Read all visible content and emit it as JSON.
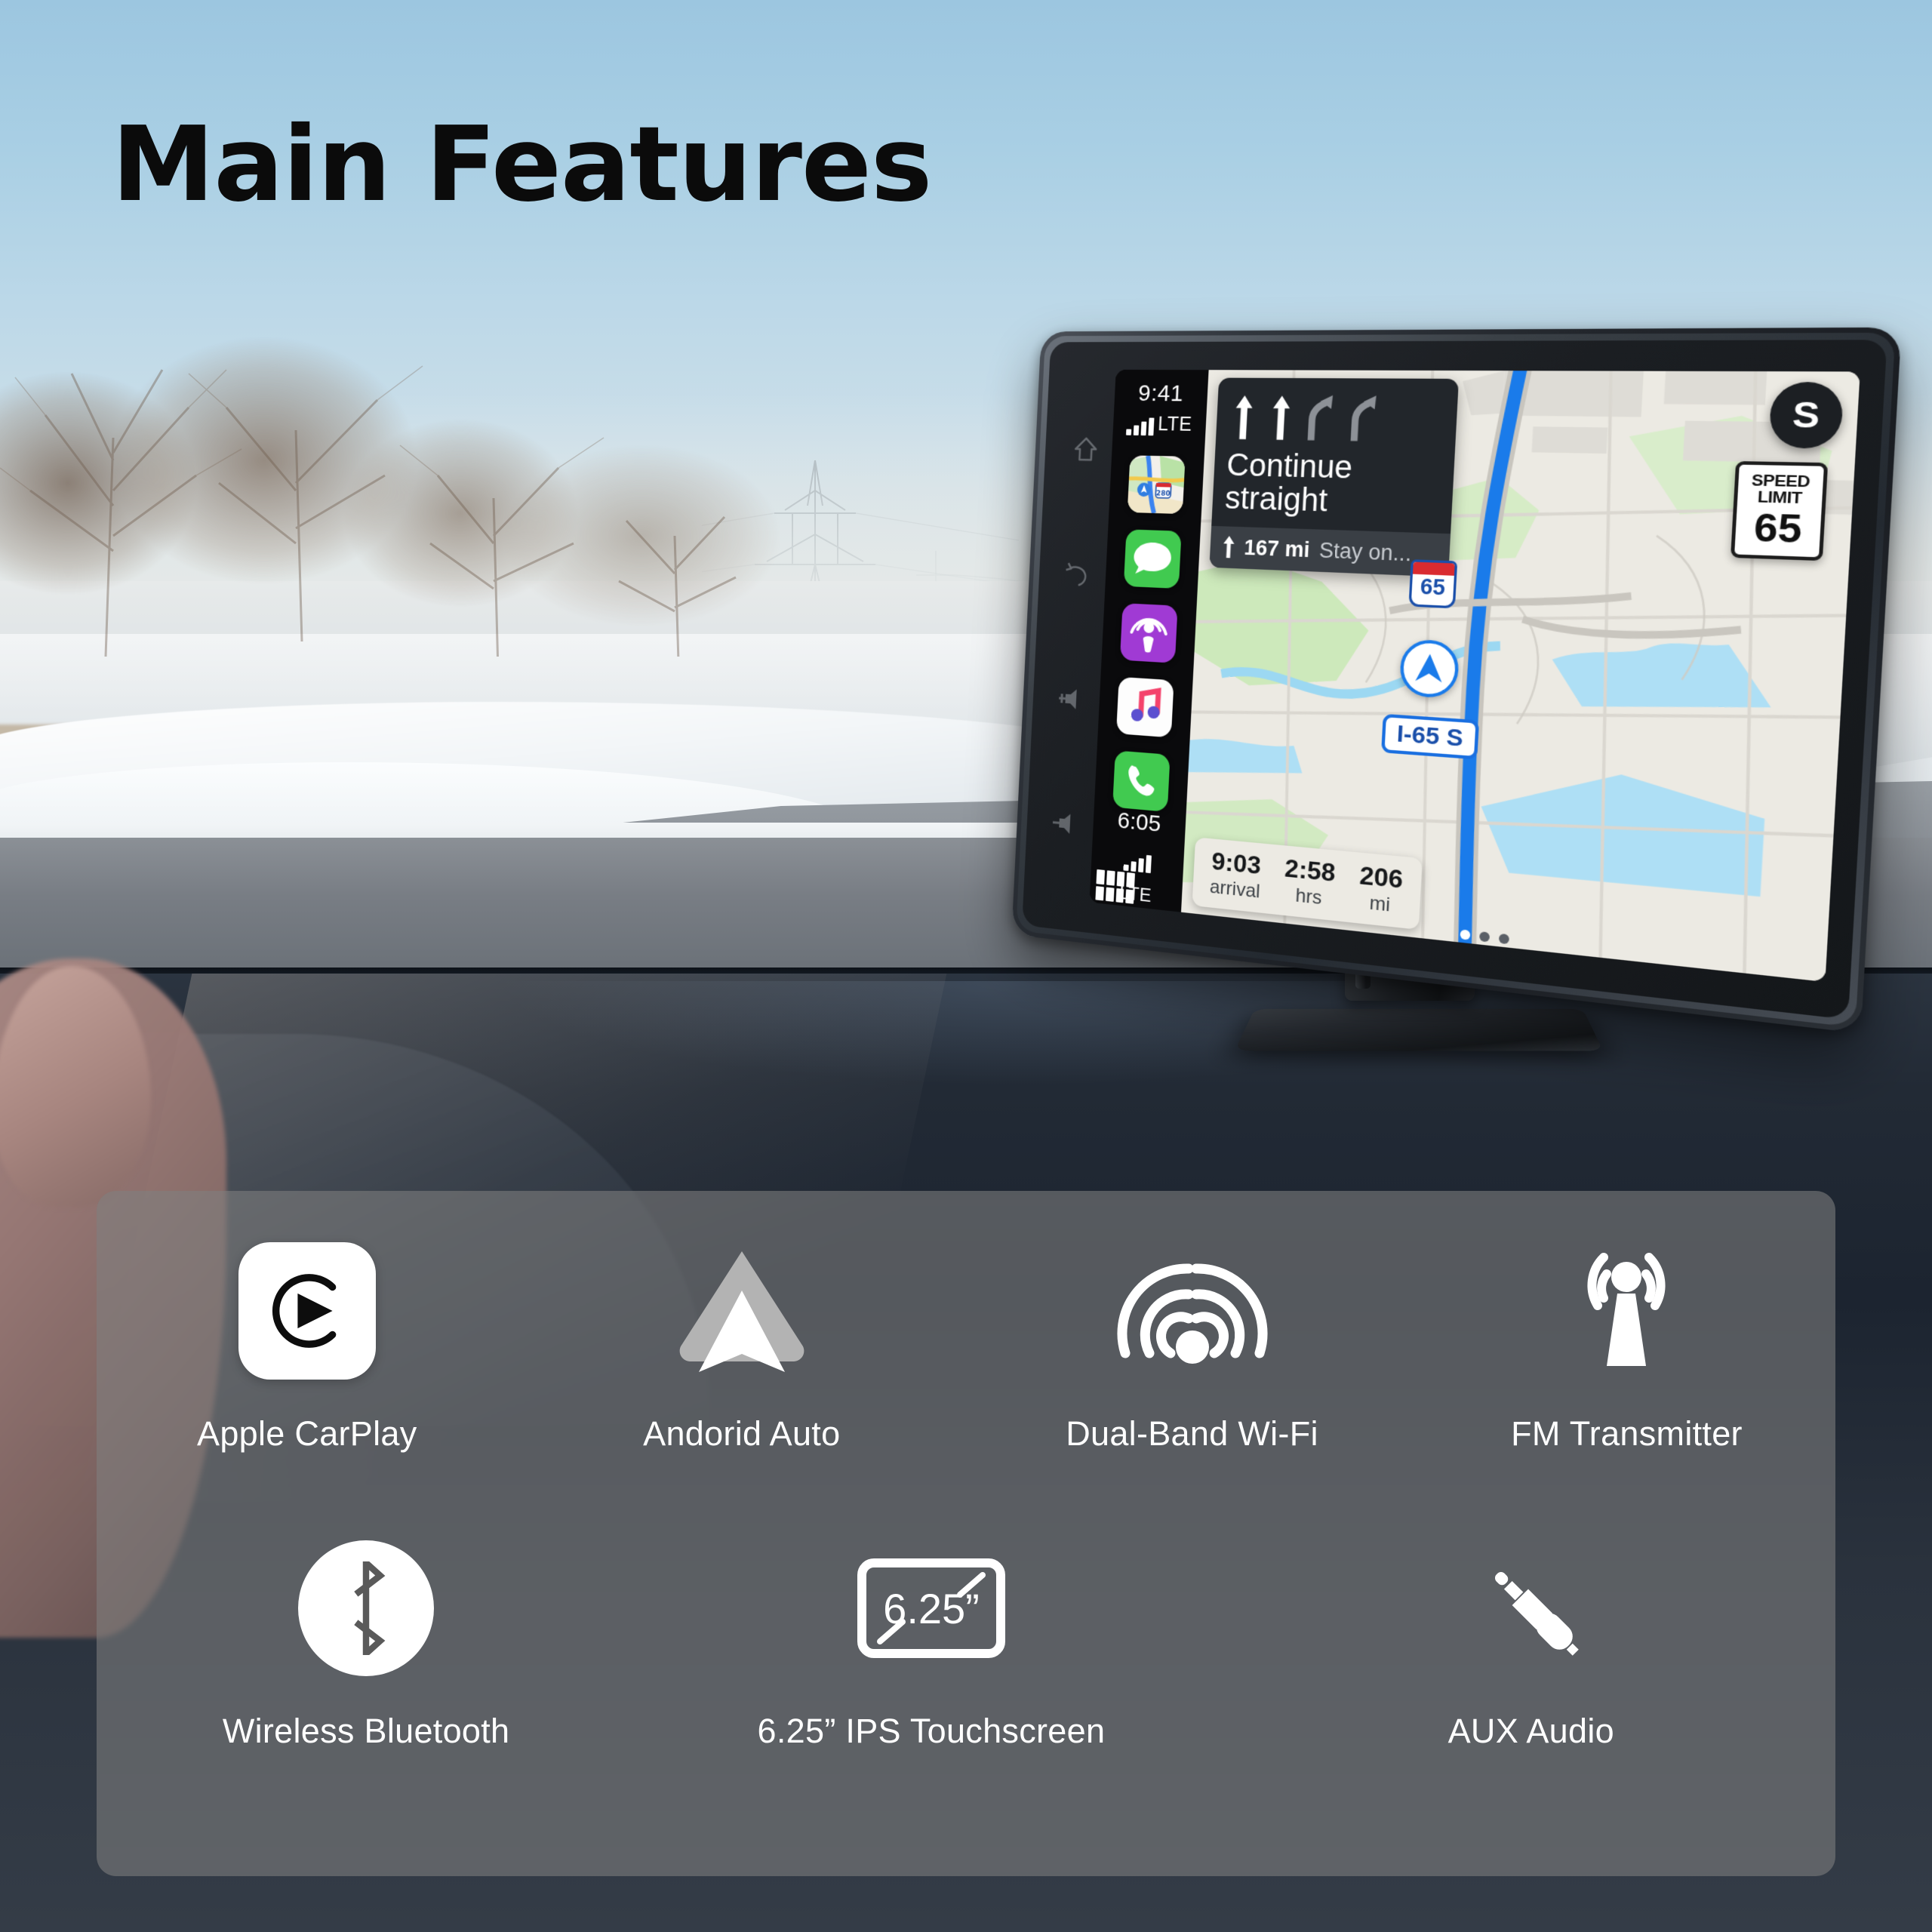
{
  "page": {
    "title": "Main Features"
  },
  "device": {
    "carplay": {
      "status_time": "9:41",
      "status_network": "LTE",
      "bottom_time": "6:05",
      "bottom_network": "LTE",
      "app_icons": [
        "maps-icon",
        "messages-icon",
        "podcasts-icon",
        "music-icon",
        "phone-icon"
      ],
      "home_button": "home-button",
      "grid_button": "app-grid-button"
    },
    "navigation": {
      "instruction": "Continue\nstraight",
      "instruction_line1": "Continue",
      "instruction_line2": "straight",
      "next_distance": "167 mi",
      "next_street": "Stay on...",
      "lane_arrows": [
        "straight",
        "straight",
        "slight-right",
        "slight-right"
      ],
      "settings_badge": "S",
      "speed_limit_label_line1": "SPEED",
      "speed_limit_label_line2": "LIMIT",
      "speed_limit_value": "65",
      "route_shield": "65",
      "route_label": "I-65 S",
      "eta": [
        {
          "value": "9:03",
          "label": "arrival"
        },
        {
          "value": "2:58",
          "label": "hrs"
        },
        {
          "value": "206",
          "label": "mi"
        }
      ],
      "page_dots": 3,
      "active_dot": 0
    },
    "bezel_buttons": [
      "home-icon",
      "return-icon",
      "volume-up-icon",
      "volume-down-icon"
    ]
  },
  "features": {
    "row1": [
      {
        "icon": "apple-carplay-icon",
        "label": "Apple CarPlay"
      },
      {
        "icon": "android-auto-icon",
        "label": "Andorid Auto"
      },
      {
        "icon": "dual-band-wifi-icon",
        "label": "Dual-Band Wi-Fi"
      },
      {
        "icon": "fm-transmitter-icon",
        "label": "FM Transmitter"
      }
    ],
    "row2": [
      {
        "icon": "bluetooth-icon",
        "label": "Wireless Bluetooth"
      },
      {
        "icon": "screen-size-icon",
        "label": "6.25” IPS Touchscreen",
        "inline_text": "6.25”"
      },
      {
        "icon": "aux-audio-icon",
        "label": "AUX Audio"
      }
    ]
  },
  "colors": {
    "title": "#0b0b0b",
    "panel_overlay": "rgba(128,128,128,0.58)",
    "label_text": "#ffffff",
    "route_blue": "#1a7bea",
    "shield_blue": "#1a4faa",
    "shield_red": "#d92b30",
    "map_land": "#eceae3",
    "map_green": "#c9e6b4",
    "map_water": "#a9dbf0"
  }
}
